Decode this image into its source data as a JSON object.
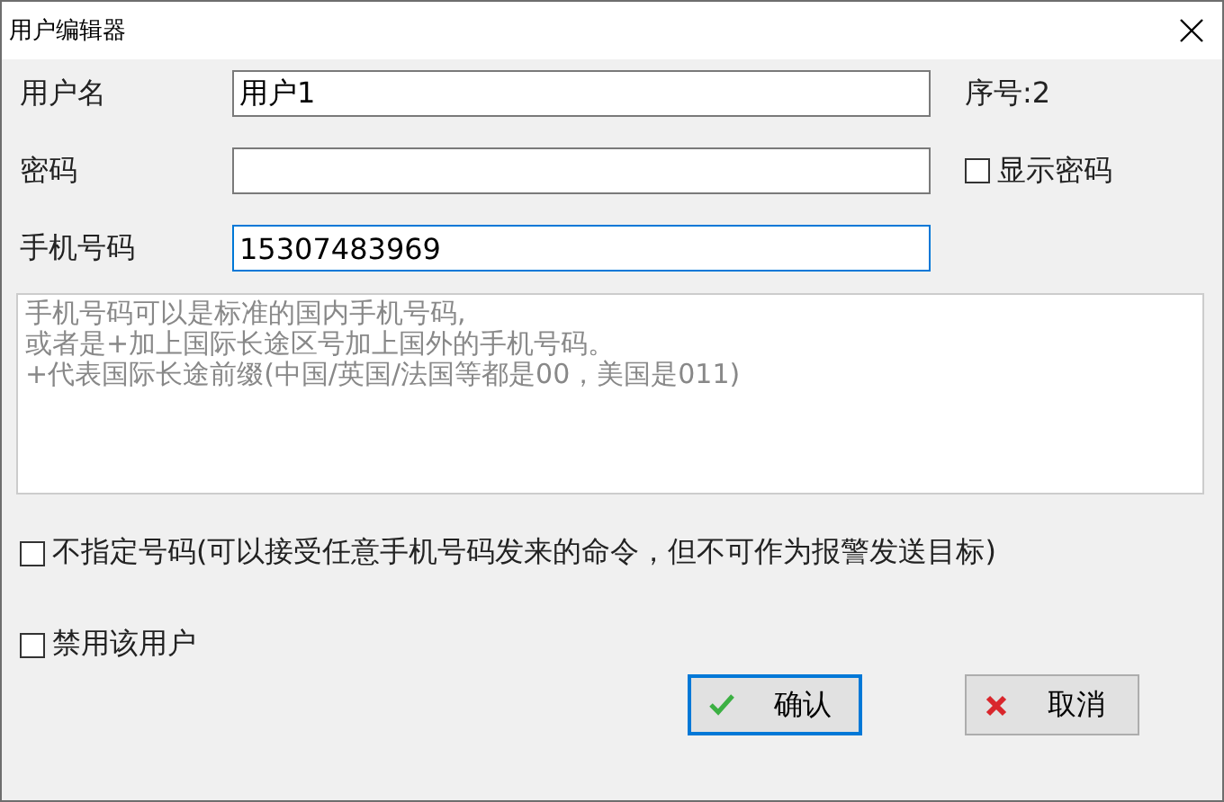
{
  "window": {
    "title": "用户编辑器"
  },
  "fields": [
    {
      "label": "用户名",
      "value": "用户1",
      "focused": false
    },
    {
      "label": "密码",
      "focused": false
    },
    {
      "label": "手机号码",
      "value": "15307483969",
      "focused": true
    }
  ],
  "serial": "序号:2",
  "show_password": {
    "label": "显示密码",
    "checked": false
  },
  "hint_lines": [
    "手机号码可以是标准的国内手机号码,",
    "或者是+加上国际长途区号加上国外的手机号码。",
    "+代表国际长途前缀(中国/英国/法国等都是00，美国是011)"
  ],
  "options": [
    {
      "label": "不指定号码(可以接受任意手机号码发来的命令，但不可作为报警发送目标)",
      "checked": false
    },
    {
      "label": "禁用该用户",
      "checked": false
    }
  ],
  "buttons": [
    {
      "label": "确认",
      "kind": "ok",
      "focused": true
    },
    {
      "label": "取消",
      "kind": "cancel",
      "focused": false
    }
  ]
}
